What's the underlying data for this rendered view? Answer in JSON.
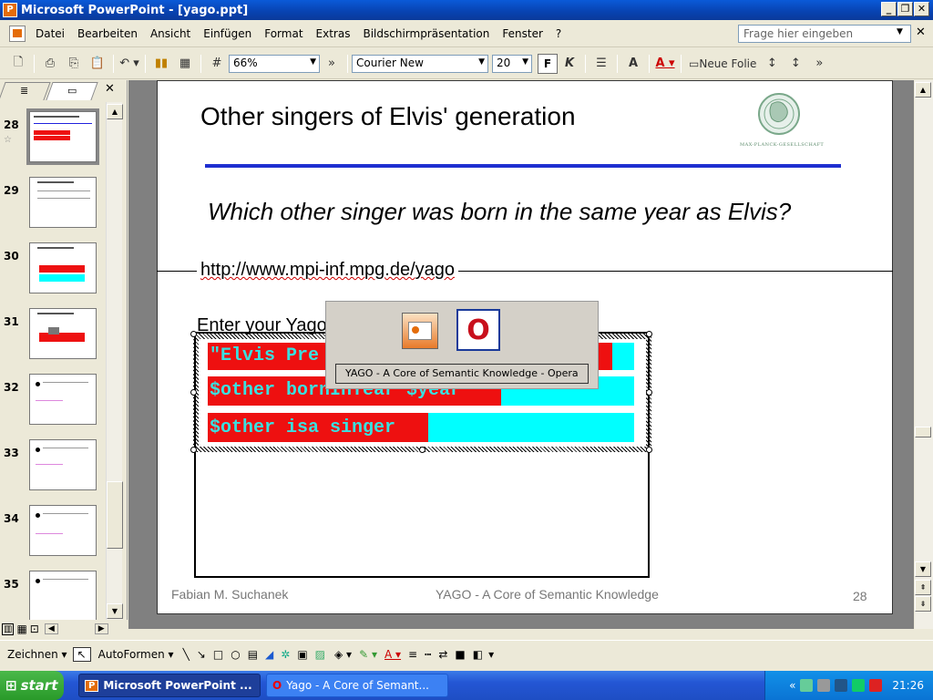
{
  "window": {
    "title": "Microsoft PowerPoint - [yago.ppt]",
    "app_icon": "P"
  },
  "menu": {
    "items": [
      "Datei",
      "Bearbeiten",
      "Ansicht",
      "Einfügen",
      "Format",
      "Extras",
      "Bildschirmpräsentation",
      "Fenster",
      "?"
    ],
    "help_placeholder": "Frage hier eingeben"
  },
  "toolbar": {
    "zoom": "66%",
    "font": "Courier New",
    "font_size": "20",
    "bold": "F",
    "italic": "K",
    "new_slide": "Neue Folie"
  },
  "thumbnails": [
    {
      "num": "28"
    },
    {
      "num": "29"
    },
    {
      "num": "30"
    },
    {
      "num": "31"
    },
    {
      "num": "32"
    },
    {
      "num": "33"
    },
    {
      "num": "34"
    },
    {
      "num": "35"
    }
  ],
  "slide": {
    "title": "Other singers of Elvis' generation",
    "logo_text": "MAX-PLANCK-GESELLSCHAFT",
    "question": "Which other singer was born in the same year as Elvis?",
    "url": "http://www.mpi-inf.mpg.de/yago",
    "enter_label": "Enter your Yago",
    "query_lines": [
      "\"Elvis Pre",
      "$other bornInYear $year",
      "$other isa singer"
    ],
    "footer_left": "Fabian M. Suchanek",
    "footer_mid": "YAGO - A Core of Semantic Knowledge",
    "footer_right": "28"
  },
  "alttab": {
    "label": "YAGO - A Core of Semantic Knowledge - Opera"
  },
  "drawbar": {
    "draw": "Zeichnen",
    "autoshapes": "AutoFormen"
  },
  "taskbar": {
    "start": "start",
    "tasks": [
      "Microsoft PowerPoint ...",
      "Yago - A Core of Semant..."
    ],
    "clock": "21:26"
  }
}
